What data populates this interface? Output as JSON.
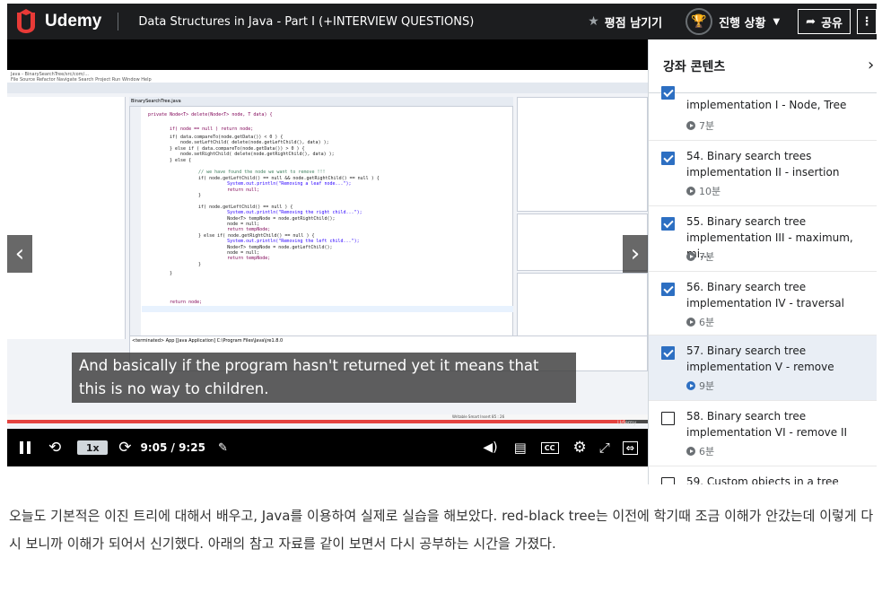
{
  "header": {
    "brand": "Udemy",
    "course_title": "Data Structures in Java - Part I (+INTERVIEW QUESTIONS)",
    "rate_label": "평점 남기기",
    "progress_label": "진행 상황",
    "share_label": "공유",
    "more_label": "⋮"
  },
  "player": {
    "caption_line1": "And basically if the program hasn't returned yet it means that",
    "caption_line2": "this is no way to children.",
    "speed": "1x",
    "time": "9:05 / 9:25",
    "progress": 0.965,
    "watermark": "Udemy"
  },
  "ide": {
    "title": "Java - BinarySearchTree/src/com/...",
    "menu": "File  Source  Refactor  Navigate  Search  Project  Run  Window  Help",
    "editor_tab": "BinarySearchTree.java",
    "code": [
      {
        "t": "private Node<T> delete(Node<T> node, T data) {",
        "k": "k"
      },
      {
        "t": "if( node == null ) return node;",
        "k": "k"
      },
      {
        "t": "if( data.compareTo(node.getData()) < 0 ) {",
        "k": ""
      },
      {
        "t": "    node.setLeftChild( delete(node.getLeftChild(), data) );",
        "k": ""
      },
      {
        "t": "} else if ( data.compareTo(node.getData()) > 0 ) {",
        "k": ""
      },
      {
        "t": "    node.setRightChild( delete(node.getRightChild(), data) );",
        "k": ""
      },
      {
        "t": "} else {",
        "k": ""
      },
      {
        "t": "    // we have found the node we want to remove !!!",
        "k": "c"
      },
      {
        "t": "    if( node.getLeftChild() == null && node.getRightChild() == null ) {",
        "k": ""
      },
      {
        "t": "        System.out.println(\"Removing a leaf node...\");",
        "k": "s"
      },
      {
        "t": "        return null;",
        "k": "k"
      },
      {
        "t": "    }",
        "k": ""
      },
      {
        "t": "    if( node.getLeftChild() == null ) {",
        "k": ""
      },
      {
        "t": "        System.out.println(\"Removing the right child...\");",
        "k": "s"
      },
      {
        "t": "        Node<T> tempNode = node.getRightChild();",
        "k": ""
      },
      {
        "t": "        node = null;",
        "k": ""
      },
      {
        "t": "        return tempNode;",
        "k": "k"
      },
      {
        "t": "    } else if( node.getRightChild() == null ) {",
        "k": ""
      },
      {
        "t": "        System.out.println(\"Removing the left child...\");",
        "k": "s"
      },
      {
        "t": "        Node<T> tempNode = node.getLeftChild();",
        "k": ""
      },
      {
        "t": "        node = null;",
        "k": ""
      },
      {
        "t": "        return tempNode;",
        "k": "k"
      },
      {
        "t": "    }",
        "k": ""
      },
      {
        "t": "}",
        "k": ""
      },
      {
        "t": "return node;",
        "k": "k"
      }
    ],
    "console_line": "<terminated> App [Java Application] C:\\Program Files\\Java\\jre1.8.0",
    "status_text": "Writable    Smart Insert    85 : 26"
  },
  "sidebar": {
    "title": "강좌 콘텐츠",
    "close": "›",
    "lessons": [
      {
        "title": "implementation I - Node, Tree",
        "duration": "7분",
        "checked": true,
        "active": false
      },
      {
        "title": "54. Binary search trees\nimplementation II - insertion",
        "duration": "10분",
        "checked": true,
        "active": false
      },
      {
        "title": "55. Binary search tree\nimplementation III - maximum, mi...",
        "duration": "7분",
        "checked": true,
        "active": false
      },
      {
        "title": "56. Binary search tree\nimplementation IV - traversal",
        "duration": "6분",
        "checked": true,
        "active": false
      },
      {
        "title": "57. Binary search tree\nimplementation V - remove",
        "duration": "9분",
        "checked": true,
        "active": true
      },
      {
        "title": "58. Binary search tree\nimplementation VI - remove II",
        "duration": "6분",
        "checked": false,
        "active": false
      },
      {
        "title": "59. Custom objects in a tree",
        "duration": "",
        "checked": false,
        "active": false
      }
    ]
  },
  "article": {
    "text": "오늘도 기본적은 이진 트리에 대해서 배우고, Java를 이용하여 실제로 실습을 해보았다. red-black tree는 이전에 학기때 조금 이해가 안갔는데 이렇게 다시 보니까 이해가 되어서 신기했다. 아래의 참고 자료를 같이 보면서 다시 공부하는 시간을 가졌다."
  },
  "colors": {
    "header_bg": "#1c1d1f",
    "brand_accent": "#a435f0",
    "progress_red": "#e4433f",
    "checkbox_blue": "#2d6fc2",
    "active_lesson_bg": "#e9eef5"
  }
}
